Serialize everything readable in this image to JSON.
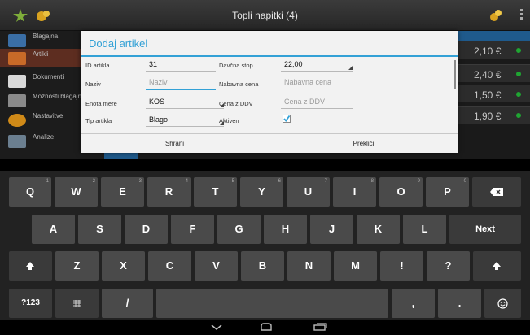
{
  "actionbar": {
    "title": "Topli napitki (4)"
  },
  "sidebar": {
    "items": [
      {
        "label": "Blagajna",
        "icon": "cash-register-icon"
      },
      {
        "label": "Artikli",
        "icon": "articles-icon"
      },
      {
        "label": "Dokumenti",
        "icon": "printer-icon"
      },
      {
        "label": "Možnosti blagajne",
        "icon": "cart-icon"
      },
      {
        "label": "Nastavitve",
        "icon": "settings-gear-icon"
      },
      {
        "label": "Analize",
        "icon": "chart-icon"
      }
    ]
  },
  "prices": [
    "2,10 €",
    "2,40 €",
    "1,50 €",
    "1,90 €"
  ],
  "dialog": {
    "title": "Dodaj artikel",
    "fields": {
      "id_label": "ID artikla",
      "id_value": "31",
      "naziv_label": "Naziv",
      "naziv_placeholder": "Naziv",
      "enota_label": "Enota mere",
      "enota_value": "KOS",
      "tip_label": "Tip artikla",
      "tip_value": "Blago",
      "davcna_label": "Davčna stop.",
      "davcna_value": "22,00",
      "nabavna_label": "Nabavna cena",
      "nabavna_placeholder": "Nabavna cena",
      "cena_label": "Cena z DDV",
      "cena_placeholder": "Cena z DDV",
      "aktiven_label": "Aktiven",
      "aktiven_checked": true
    },
    "save_label": "Shrani",
    "cancel_label": "Prekliči"
  },
  "keyboard": {
    "row1": [
      {
        "label": "Q",
        "num": "1"
      },
      {
        "label": "W",
        "num": "2"
      },
      {
        "label": "E",
        "num": "3"
      },
      {
        "label": "R",
        "num": "4"
      },
      {
        "label": "T",
        "num": "5"
      },
      {
        "label": "Y",
        "num": "6"
      },
      {
        "label": "U",
        "num": "7"
      },
      {
        "label": "I",
        "num": "8"
      },
      {
        "label": "O",
        "num": "9"
      },
      {
        "label": "P",
        "num": "0"
      }
    ],
    "row2": [
      "A",
      "S",
      "D",
      "F",
      "G",
      "H",
      "J",
      "K",
      "L"
    ],
    "row3": [
      "Z",
      "X",
      "C",
      "V",
      "B",
      "N",
      "M",
      "!",
      "?"
    ],
    "next_label": "Next",
    "symbols_label": "?123",
    "slash_label": "/",
    "comma_label": ",",
    "period_label": "."
  },
  "colors": {
    "accent": "#33a1d6",
    "active_green": "#1fa532",
    "sidebar_active": "#5d2d20"
  }
}
